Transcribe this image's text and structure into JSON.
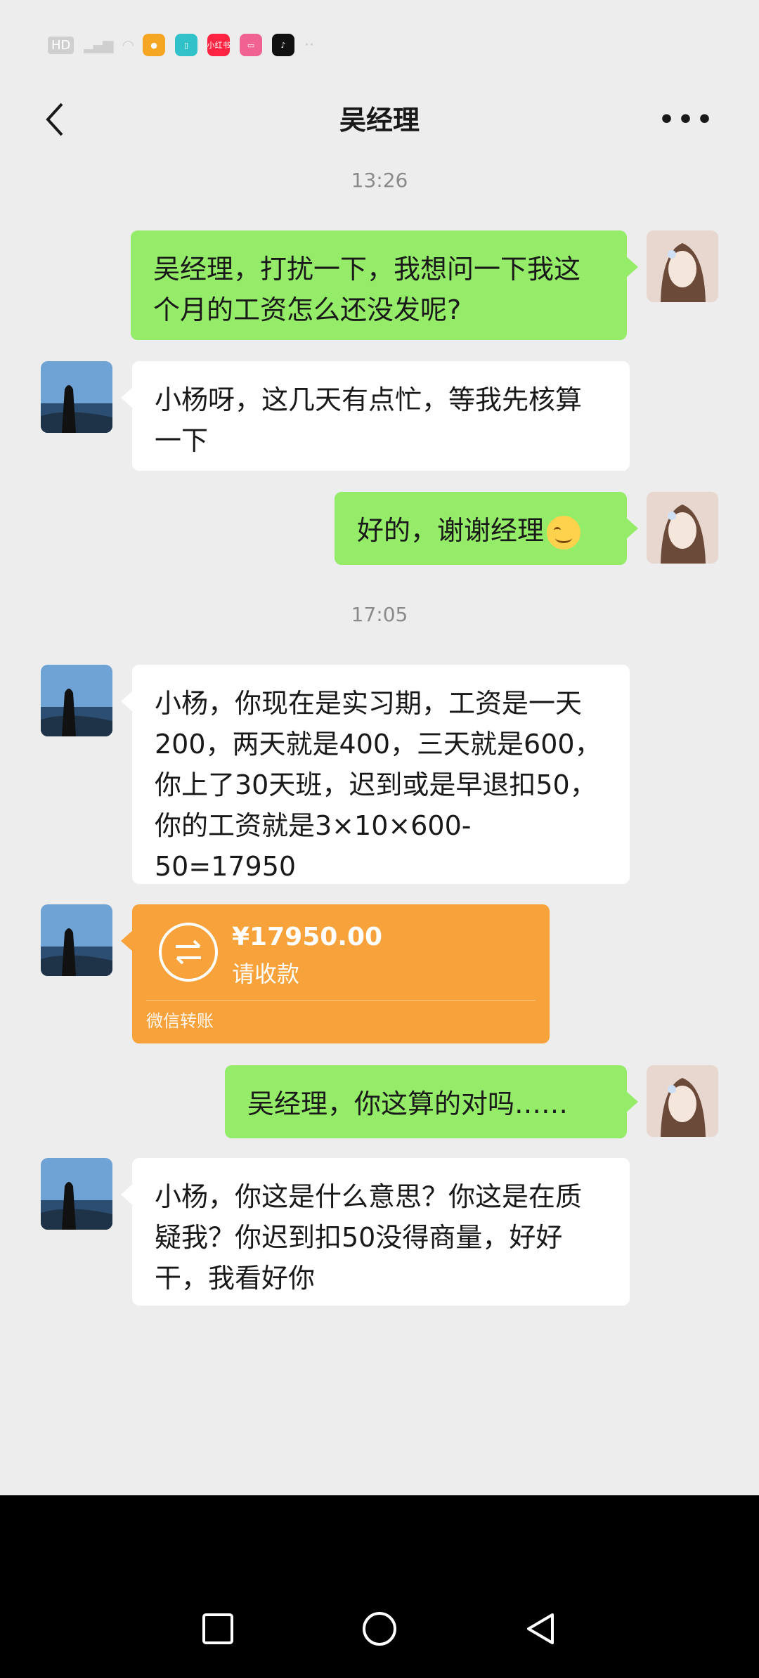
{
  "status_bar": {
    "hd": "HD",
    "network": "5G",
    "apps": [
      {
        "name": "weibo-icon",
        "label": "",
        "color": "#f5a623"
      },
      {
        "name": "book-icon",
        "label": "",
        "color": "#31c2c9"
      },
      {
        "name": "xiaohongshu-icon",
        "label": "小红书",
        "color": "#ff2442"
      },
      {
        "name": "app-icon",
        "label": "",
        "color": "#f06292"
      },
      {
        "name": "tiktok-icon",
        "label": "",
        "color": "#111111"
      }
    ],
    "more": "··"
  },
  "header": {
    "title": "吴经理"
  },
  "timestamps": [
    "13:26",
    "17:05"
  ],
  "messages": [
    {
      "side": "right",
      "text": "吴经理，打扰一下，我想问一下我这个月的工资怎么还没发呢?"
    },
    {
      "side": "left",
      "text": "小杨呀，这几天有点忙，等我先核算一下"
    },
    {
      "side": "right",
      "text": "好的，谢谢经理",
      "emoji": "smile-emoji"
    },
    {
      "side": "left",
      "text": "小杨，你现在是实习期，工资是一天200，两天就是400，三天就是600，你上了30天班，迟到或是早退扣50，你的工资就是3×10×600-50=17950"
    },
    {
      "side": "right",
      "text": "吴经理，你这算的对吗……"
    },
    {
      "side": "left",
      "text": "小杨，你这是什么意思？你这是在质疑我？你迟到扣50没得商量，好好干，我看好你"
    }
  ],
  "transfer": {
    "amount": "¥17950.00",
    "status": "请收款",
    "label": "微信转账"
  }
}
